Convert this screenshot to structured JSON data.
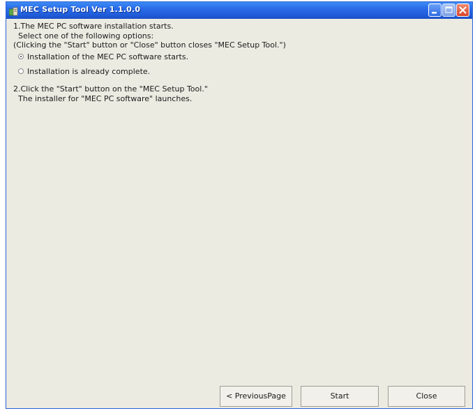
{
  "window": {
    "title": "MEC Setup Tool  Ver 1.1.0.0"
  },
  "instructions": {
    "step1_line1": "1.The MEC PC software installation starts.",
    "step1_line2": "Select one of the following options:",
    "step1_line3": "(Clicking the \"Start\" button or \"Close\" button closes \"MEC Setup Tool.\")",
    "step2_line1": "2.Click the \"Start\" button on the \"MEC Setup Tool.\"",
    "step2_line2": "The installer for \"MEC PC software\" launches."
  },
  "options": [
    {
      "label": "Installation of the MEC PC software starts.",
      "selected": true
    },
    {
      "label": "Installation is already complete.",
      "selected": false
    }
  ],
  "buttons": {
    "previous": "< PreviousPage",
    "start": "Start",
    "close": "Close"
  },
  "icons": {
    "app": "setup-app-icon",
    "minimize": "minimize-icon",
    "maximize": "maximize-icon",
    "close": "close-x-icon"
  }
}
